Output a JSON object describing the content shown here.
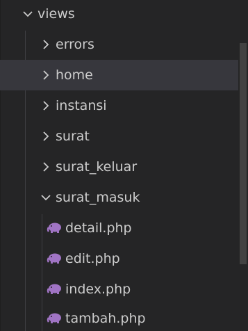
{
  "explorer": {
    "root_folder": {
      "label": "views",
      "expanded": true
    },
    "folders": [
      {
        "label": "errors",
        "expanded": false
      },
      {
        "label": "home",
        "expanded": false,
        "selected": true
      },
      {
        "label": "instansi",
        "expanded": false
      },
      {
        "label": "surat",
        "expanded": false
      },
      {
        "label": "surat_keluar",
        "expanded": false
      },
      {
        "label": "surat_masuk",
        "expanded": true
      }
    ],
    "files": [
      {
        "label": "detail.php",
        "icon": "php-elephant-icon"
      },
      {
        "label": "edit.php",
        "icon": "php-elephant-icon"
      },
      {
        "label": "index.php",
        "icon": "php-elephant-icon"
      },
      {
        "label": "tambah.php",
        "icon": "php-elephant-icon"
      }
    ]
  },
  "colors": {
    "background": "#252526",
    "selected_row": "#37373d",
    "text": "#cccccc",
    "indent_guide": "#3e3e42",
    "php_icon": "#a074c4",
    "scrollbar_thumb": "#424242"
  }
}
